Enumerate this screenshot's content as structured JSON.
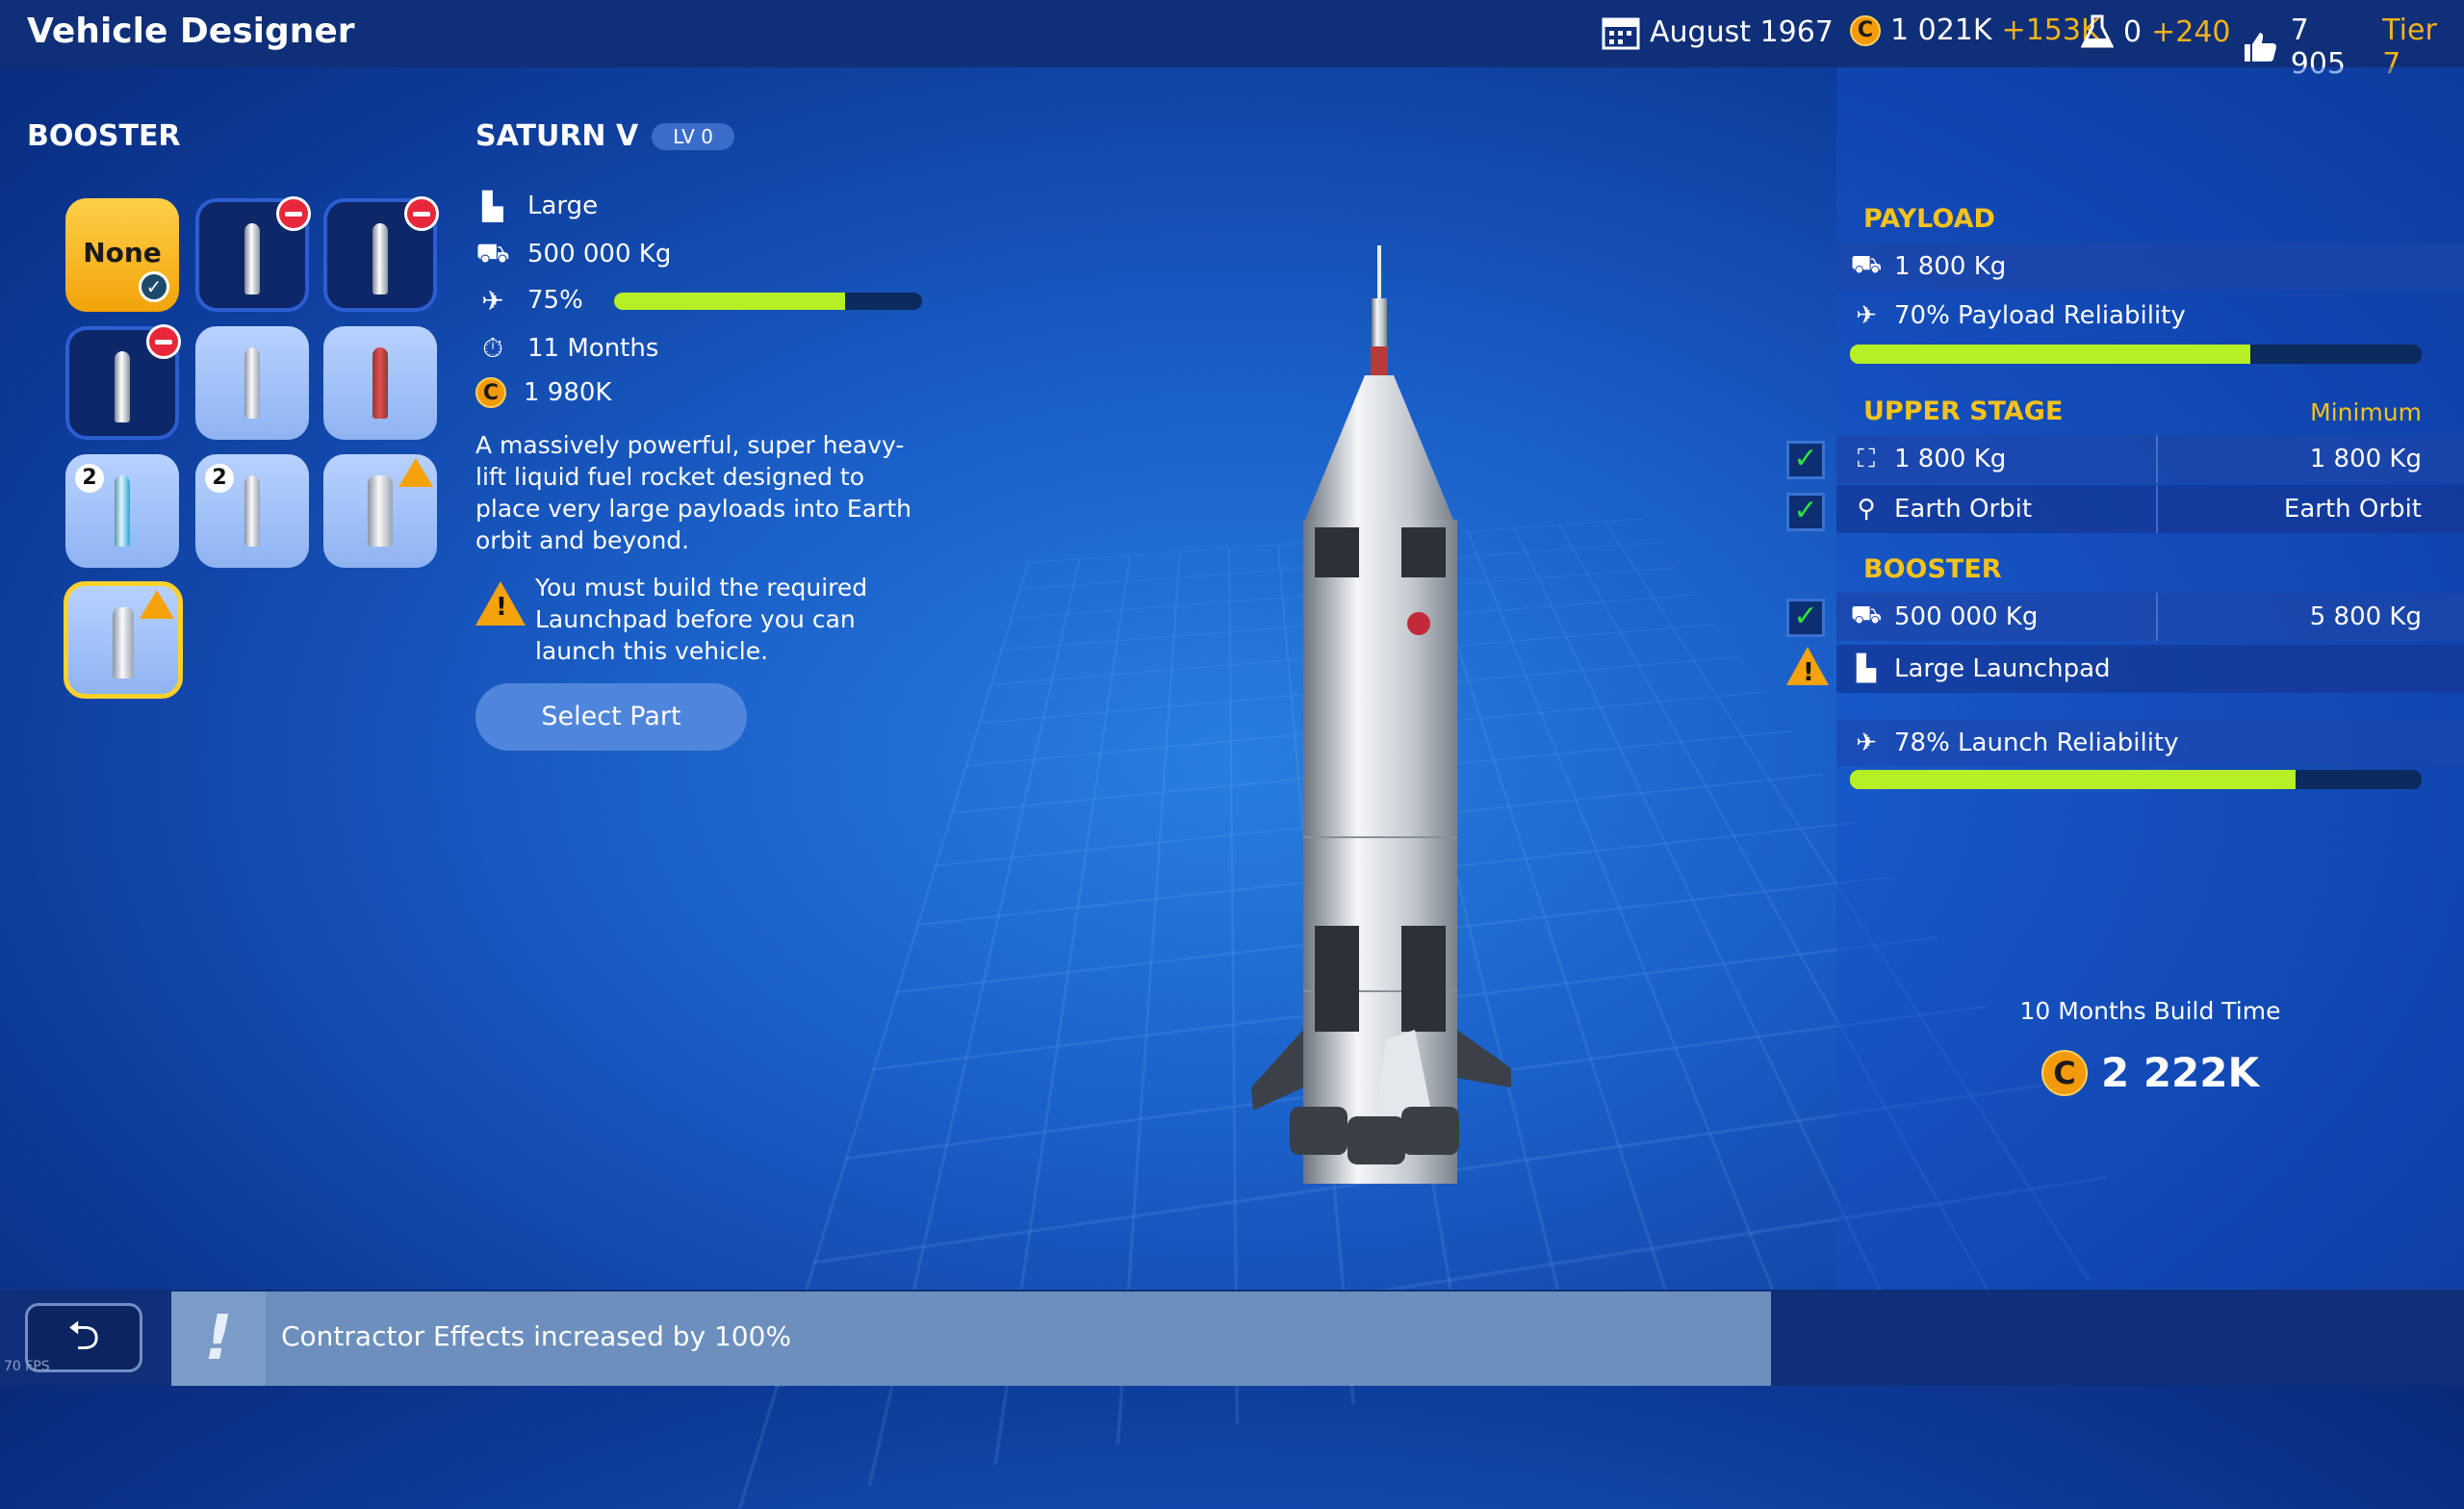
{
  "app": {
    "title": "Vehicle Designer"
  },
  "topbar": {
    "date": "August 1967",
    "money": "1 021K",
    "money_delta": "+153K",
    "science": "0",
    "science_delta": "+240",
    "reputation": "7 905",
    "tier": "Tier 7",
    "coin_glyph": "C"
  },
  "booster_section": {
    "title": "BOOSTER",
    "none_label": "None",
    "tile_badge_2a": "2",
    "tile_badge_2b": "2"
  },
  "part": {
    "name": "SATURN V",
    "level": "LV 0",
    "size": "Large",
    "capacity": "500 000 Kg",
    "reliability": "75%",
    "reliability_fraction": 0.75,
    "build_time": "11 Months",
    "cost": "1 980K",
    "description": "A massively powerful, super heavy-lift liquid fuel rocket designed to place very large payloads into Earth orbit and beyond.",
    "warning": "You must build the required Launchpad before you can launch this vehicle.",
    "select_label": "Select Part"
  },
  "summary": {
    "payload_title": "PAYLOAD",
    "payload_mass": "1 800 Kg",
    "payload_reliability": "70% Payload Reliability",
    "payload_reliability_fraction": 0.7,
    "upper_title": "UPPER STAGE",
    "upper_minimum": "Minimum",
    "upper_mass": "1 800 Kg",
    "upper_mass_min": "1 800 Kg",
    "upper_target": "Earth Orbit",
    "upper_target_min": "Earth Orbit",
    "booster_title": "BOOSTER",
    "booster_capacity": "500 000 Kg",
    "booster_capacity_min": "5 800 Kg",
    "booster_launchpad": "Large Launchpad",
    "launch_reliability": "78% Launch Reliability",
    "launch_reliability_fraction": 0.78,
    "build_time": "10 Months Build Time",
    "total_cost": "2 222K"
  },
  "footer": {
    "notice": "Contractor Effects increased by 100%",
    "notice_mark": "!",
    "fps": "70 FPS"
  },
  "colors": {
    "accent_gold": "#f6c21c",
    "bar_green": "#b7ef26",
    "warn_orange": "#f6a20c",
    "deny_red": "#e8283a"
  }
}
